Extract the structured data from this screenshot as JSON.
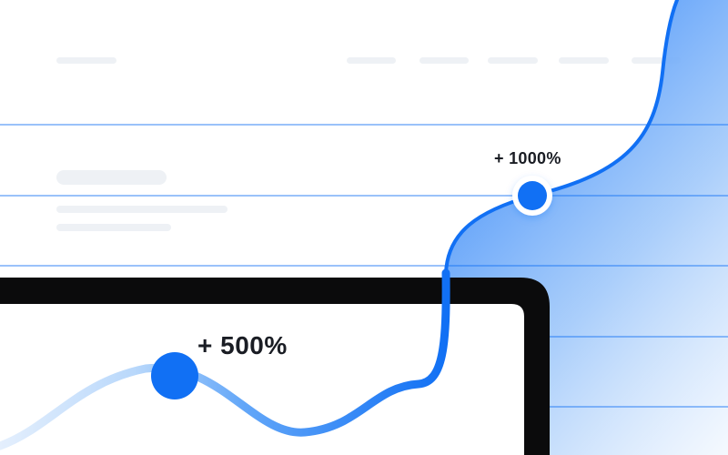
{
  "annotations": {
    "high_label": "+ 1000%",
    "low_label": "+ 500%"
  },
  "colors": {
    "accent": "#1170f4",
    "accent_light": "#b9d8fb",
    "device_frame": "#0b0b0c",
    "placeholder": "#eef1f5"
  }
}
